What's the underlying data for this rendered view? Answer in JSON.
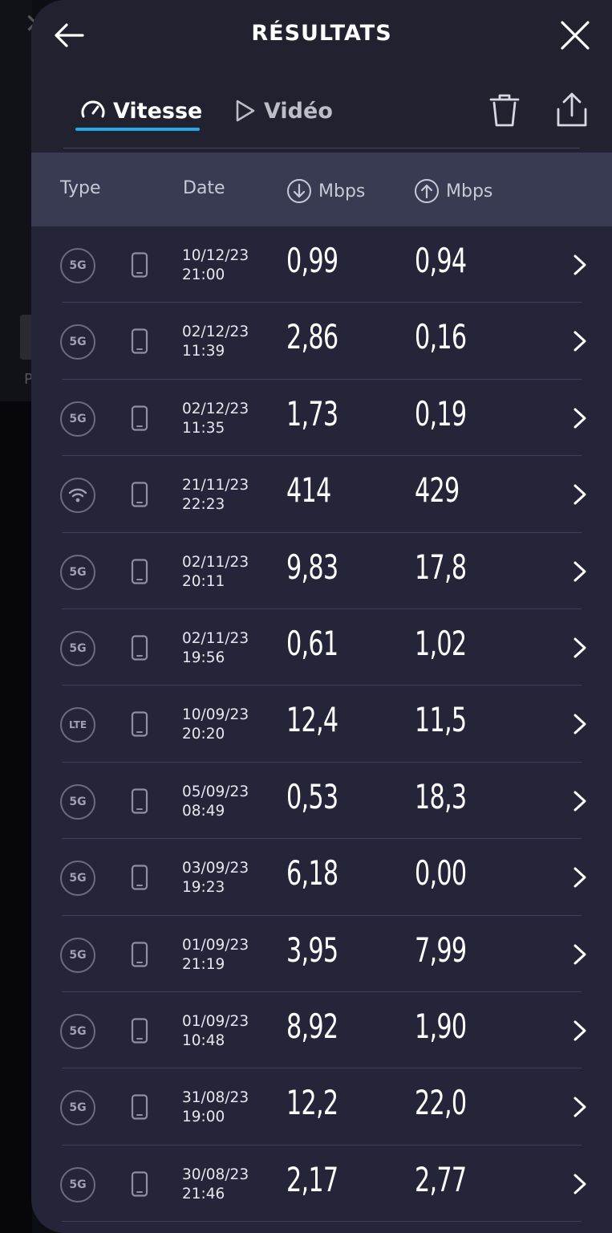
{
  "header": {
    "title": "RÉSULTATS"
  },
  "tabs": [
    {
      "label": "Vitesse",
      "active": true
    },
    {
      "label": "Vidéo",
      "active": false
    }
  ],
  "columns": {
    "type": "Type",
    "date": "Date",
    "download": "Mbps",
    "upload": "Mbps"
  },
  "colors": {
    "accent": "#23a8e8",
    "sheet": "#252539",
    "header_row": "#393b53"
  },
  "results": [
    {
      "net": "5G",
      "net_icon": "5g",
      "device": "phone-icon",
      "date": "10/12/23",
      "time": "21:00",
      "down": "0,99",
      "up": "0,94"
    },
    {
      "net": "5G",
      "net_icon": "5g",
      "device": "phone-icon",
      "date": "02/12/23",
      "time": "11:39",
      "down": "2,86",
      "up": "0,16"
    },
    {
      "net": "5G",
      "net_icon": "5g",
      "device": "phone-icon",
      "date": "02/12/23",
      "time": "11:35",
      "down": "1,73",
      "up": "0,19"
    },
    {
      "net": "",
      "net_icon": "wifi",
      "device": "phone-icon",
      "date": "21/11/23",
      "time": "22:23",
      "down": "414",
      "up": "429"
    },
    {
      "net": "5G",
      "net_icon": "5g",
      "device": "phone-icon",
      "date": "02/11/23",
      "time": "20:11",
      "down": "9,83",
      "up": "17,8"
    },
    {
      "net": "5G",
      "net_icon": "5g",
      "device": "phone-icon",
      "date": "02/11/23",
      "time": "19:56",
      "down": "0,61",
      "up": "1,02"
    },
    {
      "net": "LTE",
      "net_icon": "lte",
      "device": "phone-icon",
      "date": "10/09/23",
      "time": "20:20",
      "down": "12,4",
      "up": "11,5"
    },
    {
      "net": "5G",
      "net_icon": "5g",
      "device": "phone-icon",
      "date": "05/09/23",
      "time": "08:49",
      "down": "0,53",
      "up": "18,3"
    },
    {
      "net": "5G",
      "net_icon": "5g",
      "device": "phone-icon",
      "date": "03/09/23",
      "time": "19:23",
      "down": "6,18",
      "up": "0,00"
    },
    {
      "net": "5G",
      "net_icon": "5g",
      "device": "phone-icon",
      "date": "01/09/23",
      "time": "21:19",
      "down": "3,95",
      "up": "7,99"
    },
    {
      "net": "5G",
      "net_icon": "5g",
      "device": "phone-icon",
      "date": "01/09/23",
      "time": "10:48",
      "down": "8,92",
      "up": "1,90"
    },
    {
      "net": "5G",
      "net_icon": "5g",
      "device": "phone-icon",
      "date": "31/08/23",
      "time": "19:00",
      "down": "12,2",
      "up": "22,0"
    },
    {
      "net": "5G",
      "net_icon": "5g",
      "device": "phone-icon",
      "date": "30/08/23",
      "time": "21:46",
      "down": "2,17",
      "up": "2,77"
    }
  ]
}
